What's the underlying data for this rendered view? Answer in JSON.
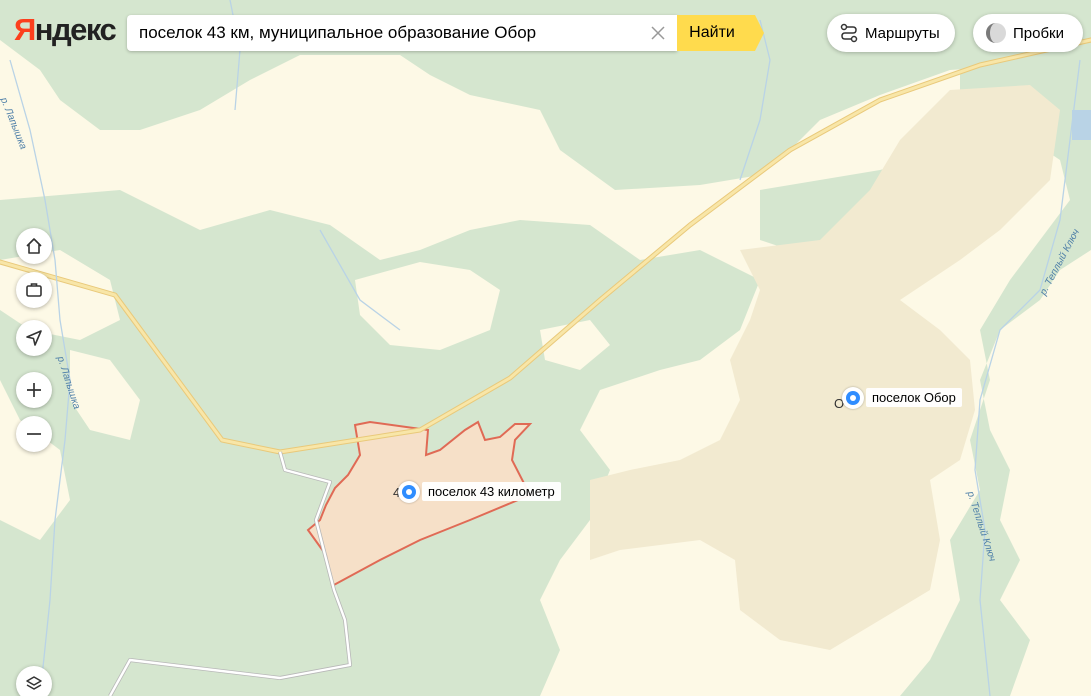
{
  "logo": {
    "first": "Я",
    "rest": "ндекс"
  },
  "search": {
    "value": "поселок 43 км, муниципальное образование Обор",
    "button": "Найти"
  },
  "header": {
    "routes_label": "Маршруты",
    "traffic_label": "Пробки"
  },
  "places": [
    {
      "label": "поселок 43 километр",
      "fragment": "4"
    },
    {
      "label": "поселок Обор",
      "fragment": "О"
    }
  ],
  "rivers": [
    "р. Лапышка",
    "р. Лапышка",
    "р. Теплый Ключ",
    "р. Теплый Ключ"
  ],
  "icons": {
    "clear": "close-icon",
    "routes": "routes-icon",
    "traffic": "traffic-icon",
    "home": "home-icon",
    "work": "briefcase-icon",
    "locate": "navigation-arrow-icon",
    "zoom_in": "plus-icon",
    "zoom_out": "minus-icon",
    "layers": "layers-icon",
    "pin": "location-pin-icon"
  },
  "colors": {
    "background": "#fdf9e6",
    "forest": "#d5e6cf",
    "settlement": "#f2ead0",
    "highlight_fill": "#f6e0c8",
    "highlight_border": "#e06a55",
    "road": "#f4df9a",
    "accent": "#ffdb4d",
    "pin": "#2f8dff",
    "logo_red": "#fc3f1d"
  }
}
